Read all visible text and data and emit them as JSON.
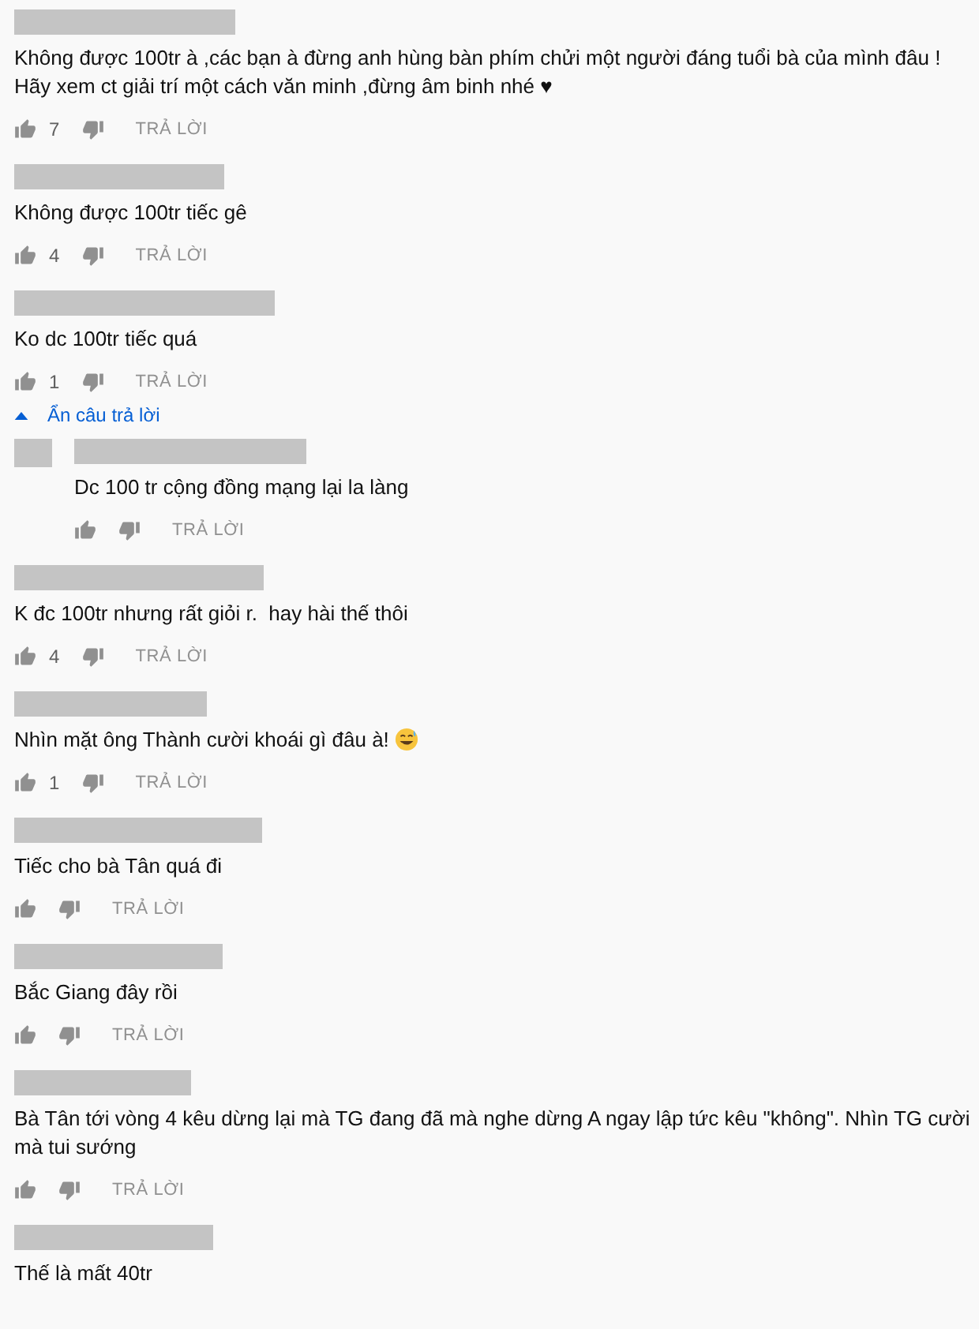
{
  "comments": [
    {
      "text": "Không được 100tr à ,các bạn à đừng anh hùng bàn phím chửi một người đáng tuổi bà của mình đâu !\nHãy xem ct giải trí một cách văn minh ,đừng âm binh nhé ♥",
      "likes": "7",
      "reply": "TRẢ LỜI"
    },
    {
      "text": "Không được 100tr tiếc gê",
      "likes": "4",
      "reply": "TRẢ LỜI"
    },
    {
      "text": "Ko dc 100tr tiếc quá",
      "likes": "1",
      "reply": "TRẢ LỜI",
      "replies_toggle": {
        "label": "Ẩn câu trả lời",
        "expanded": true
      },
      "replies": [
        {
          "text": "Dc 100 tr cộng đồng mạng lại la làng",
          "reply": "TRẢ LỜI"
        }
      ]
    },
    {
      "text": "K đc 100tr nhưng rất giỏi r.  hay hài thế thôi",
      "likes": "4",
      "reply": "TRẢ LỜI"
    },
    {
      "text": "Nhìn mặt ông Thành cười khoái gì đâu à!",
      "trailing_emoji": true,
      "likes": "1",
      "reply": "TRẢ LỜI"
    },
    {
      "text": "Tiếc cho bà Tân quá đi",
      "reply": "TRẢ LỜI"
    },
    {
      "text": "Bắc Giang đây rồi",
      "reply": "TRẢ LỜI"
    },
    {
      "text": "Bà Tân tới vòng 4 kêu dừng lại mà TG đang đã mà nghe dừng A ngay lập tức kêu \"không\". Nhìn TG cười mà tui sướng",
      "reply": "TRẢ LỜI"
    },
    {
      "text": "Thế là mất 40tr"
    }
  ]
}
